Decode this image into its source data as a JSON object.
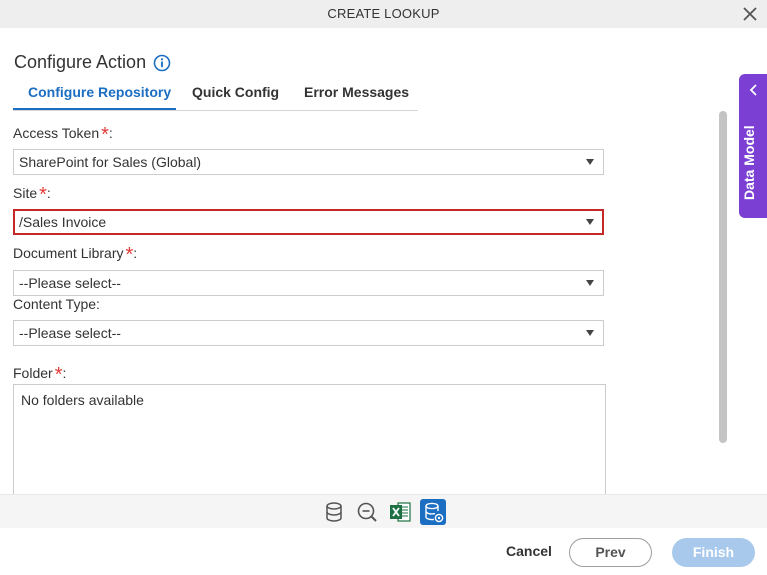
{
  "window": {
    "title": "CREATE LOOKUP",
    "close_icon": "close-icon"
  },
  "heading": {
    "title": "Configure Action",
    "info_icon": "info-icon"
  },
  "tabs": [
    {
      "label": "Configure Repository",
      "active": true
    },
    {
      "label": "Quick Config",
      "active": false
    },
    {
      "label": "Error Messages",
      "active": false
    }
  ],
  "form": {
    "access_token": {
      "label": "Access Token",
      "required_mark": "*",
      "colon": ":",
      "value": "SharePoint for Sales (Global)"
    },
    "site": {
      "label": "Site",
      "required_mark": "*",
      "colon": ":",
      "value": "/Sales Invoice"
    },
    "document_library": {
      "label": "Document Library",
      "required_mark": "*",
      "colon": ":",
      "value": "--Please select--"
    },
    "content_type": {
      "label": "Content Type:",
      "value": "--Please select--"
    },
    "folder": {
      "label": "Folder",
      "required_mark": "*",
      "colon": ":",
      "empty_text": "No folders available"
    }
  },
  "data_model": {
    "label": "Data Model"
  },
  "toolbar_icons": [
    "database-icon",
    "search-minus-icon",
    "excel-icon",
    "database-settings-icon"
  ],
  "footer": {
    "cancel": "Cancel",
    "prev": "Prev",
    "finish": "Finish"
  },
  "colors": {
    "accent": "#1b6ec2",
    "required": "#e53935",
    "error_border": "#c62828",
    "data_model_tab": "#7b3fd4",
    "finish_disabled": "#a9c9ec"
  }
}
